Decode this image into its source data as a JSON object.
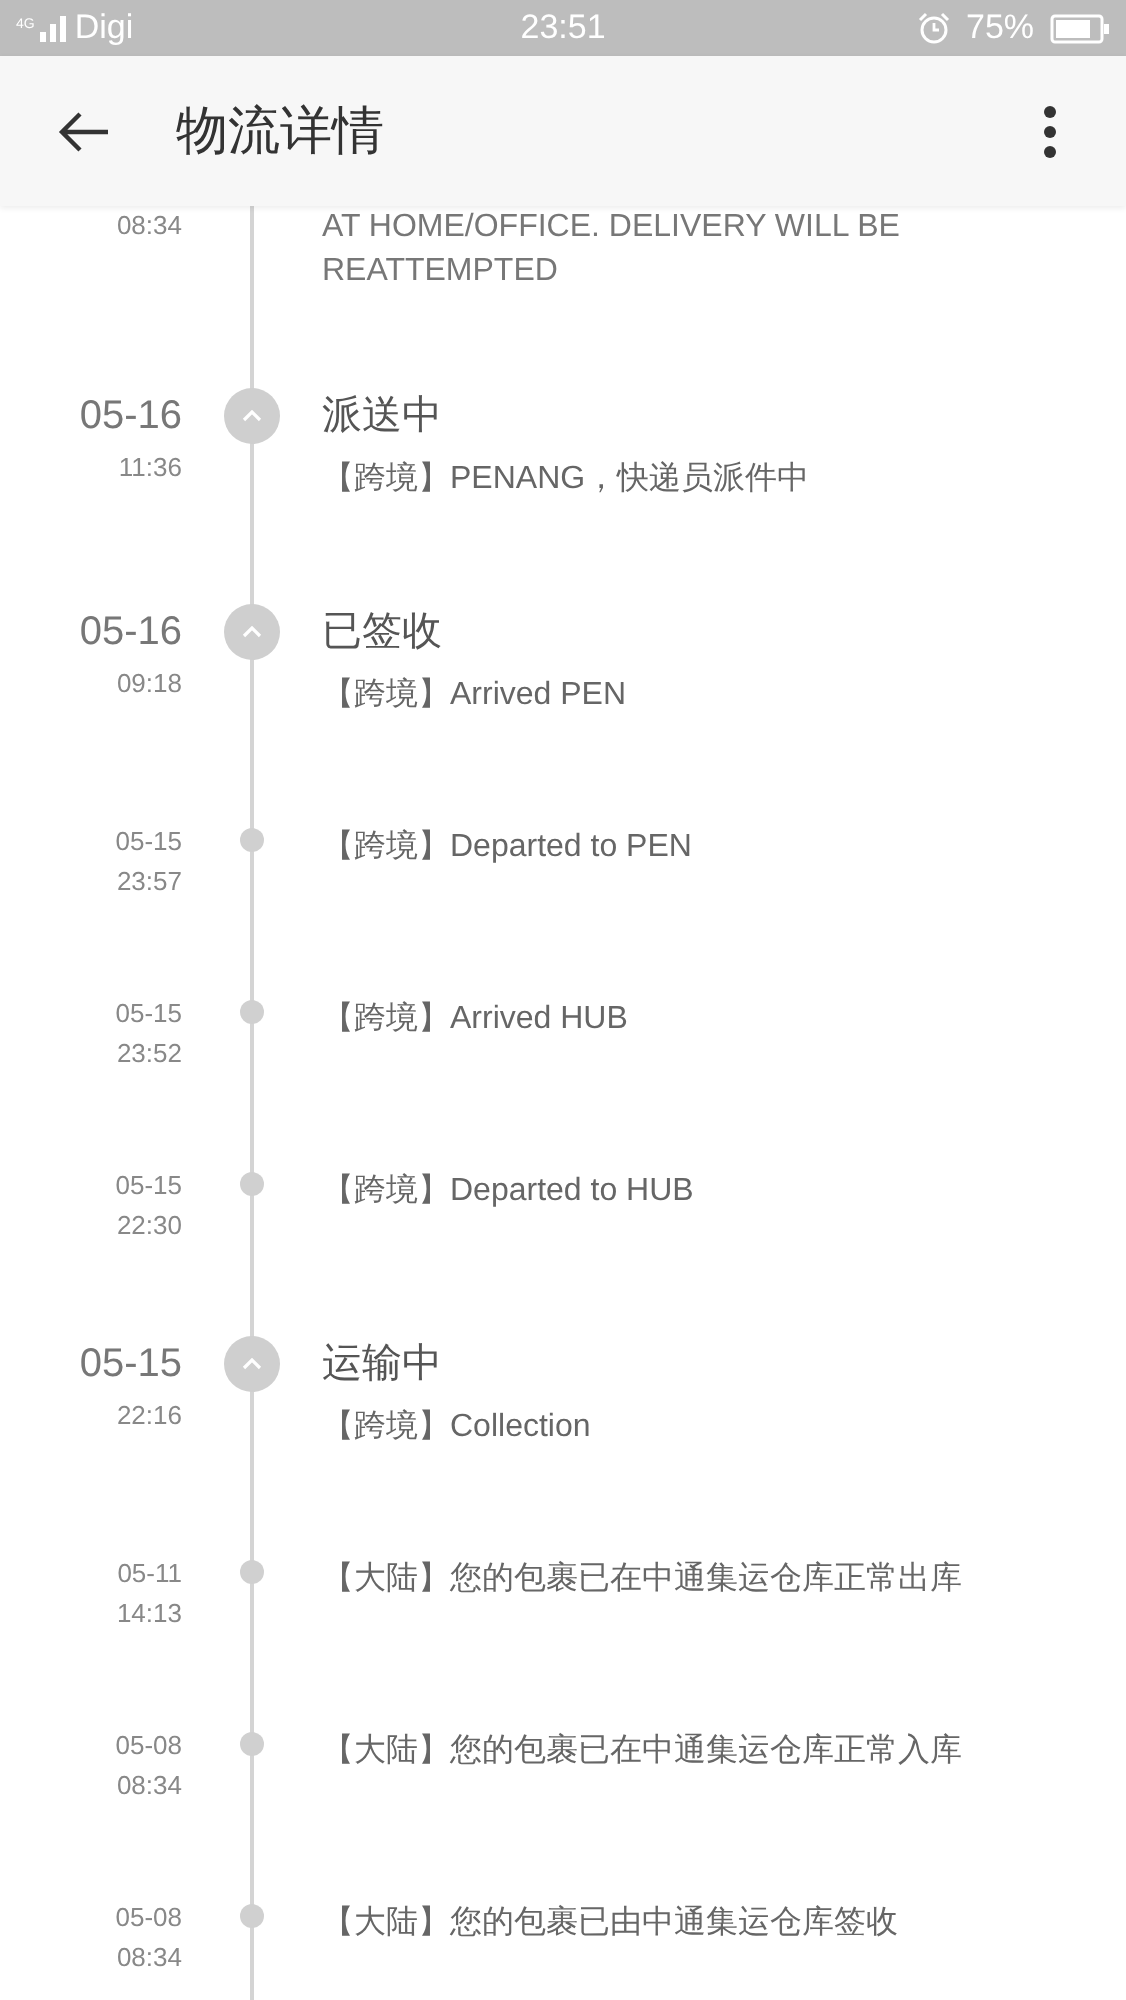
{
  "status_bar": {
    "network": "4G",
    "carrier": "Digi",
    "time": "23:51",
    "battery": "75%"
  },
  "header": {
    "title": "物流详情"
  },
  "events": [
    {
      "kind": "cut",
      "time": "08:34",
      "lines": [
        "AT HOME/OFFICE. DELIVERY WILL BE",
        "REATTEMPTED"
      ]
    },
    {
      "kind": "major",
      "date": "05-16",
      "time": "11:36",
      "status": "派送中",
      "detail": "【跨境】PENANG，快递员派件中"
    },
    {
      "kind": "major",
      "date": "05-16",
      "time": "09:18",
      "status": "已签收",
      "detail": "【跨境】Arrived PEN"
    },
    {
      "kind": "minor",
      "date": "05-15",
      "time": "23:57",
      "detail": "【跨境】Departed to PEN"
    },
    {
      "kind": "minor",
      "date": "05-15",
      "time": "23:52",
      "detail": "【跨境】Arrived HUB"
    },
    {
      "kind": "minor",
      "date": "05-15",
      "time": "22:30",
      "detail": "【跨境】Departed to HUB"
    },
    {
      "kind": "major",
      "date": "05-15",
      "time": "22:16",
      "status": "运输中",
      "detail": "【跨境】Collection"
    },
    {
      "kind": "minor",
      "date": "05-11",
      "time": "14:13",
      "detail": "【大陆】您的包裹已在中通集运仓库正常出库"
    },
    {
      "kind": "minor",
      "date": "05-08",
      "time": "08:34",
      "detail": "【大陆】您的包裹已在中通集运仓库正常入库"
    },
    {
      "kind": "minor",
      "date": "05-08",
      "time": "08:34",
      "detail": "【大陆】您的包裹已由中通集运仓库签收"
    }
  ]
}
